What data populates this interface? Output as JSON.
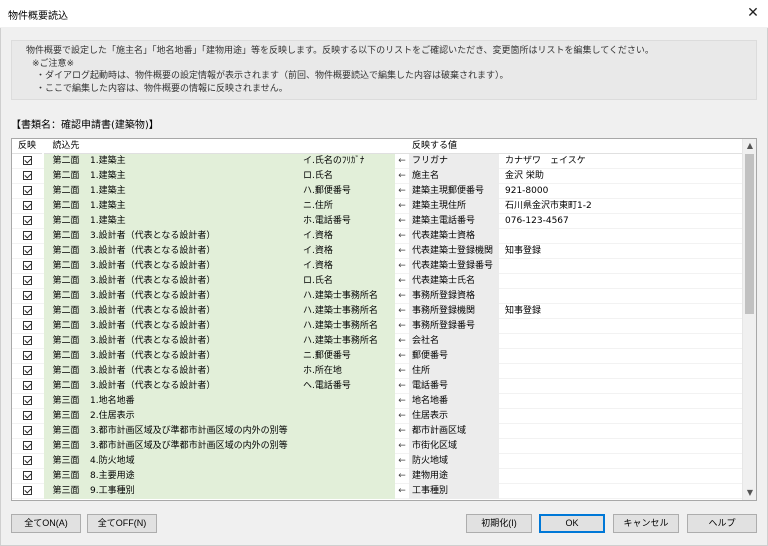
{
  "window": {
    "title": "物件概要読込",
    "close_glyph": "✕"
  },
  "notice": {
    "lines": [
      "物件概要で設定した「施主名」「地名地番」「建物用途」等を反映します。反映する以下のリストをご確認いただき、変更箇所はリストを編集してください。",
      "※ご注意※",
      "・ダイアログ起動時は、物件概要の設定情報が表示されます（前回、物件概要読込で編集した内容は破棄されます）。",
      "・ここで編集した内容は、物件概要の情報に反映されません。"
    ]
  },
  "document": {
    "name_label": "【書類名：確認申請書(建築物)】"
  },
  "grid": {
    "headers": {
      "reflect": "反映",
      "source": "読込先",
      "item": "",
      "sub": "",
      "arrow": "",
      "target": "反映する値",
      "value": ""
    },
    "rows": [
      {
        "checked": true,
        "sheet": "第二面",
        "item": "1.建築主",
        "sub": "イ.氏名のﾌﾘｶﾞﾅ",
        "arrow": "←",
        "target": "フリガナ",
        "value": "カナザワ　ェイスケ"
      },
      {
        "checked": true,
        "sheet": "第二面",
        "item": "1.建築主",
        "sub": "ロ.氏名",
        "arrow": "←",
        "target": "施主名",
        "value": "金沢 栄助"
      },
      {
        "checked": true,
        "sheet": "第二面",
        "item": "1.建築主",
        "sub": "ハ.郵便番号",
        "arrow": "←",
        "target": "建築主現郵便番号",
        "value": "921-8000"
      },
      {
        "checked": true,
        "sheet": "第二面",
        "item": "1.建築主",
        "sub": "ニ.住所",
        "arrow": "←",
        "target": "建築主現住所",
        "value": "石川県金沢市東町1-2"
      },
      {
        "checked": true,
        "sheet": "第二面",
        "item": "1.建築主",
        "sub": "ホ.電話番号",
        "arrow": "←",
        "target": "建築主電話番号",
        "value": "076-123-4567"
      },
      {
        "checked": true,
        "sheet": "第二面",
        "item": "3.設計者（代表となる設計者）",
        "sub": "イ.資格",
        "arrow": "←",
        "target": "代表建築士資格",
        "value": ""
      },
      {
        "checked": true,
        "sheet": "第二面",
        "item": "3.設計者（代表となる設計者）",
        "sub": "イ.資格",
        "arrow": "←",
        "target": "代表建築士登録機関",
        "value": "知事登録"
      },
      {
        "checked": true,
        "sheet": "第二面",
        "item": "3.設計者（代表となる設計者）",
        "sub": "イ.資格",
        "arrow": "←",
        "target": "代表建築士登録番号",
        "value": ""
      },
      {
        "checked": true,
        "sheet": "第二面",
        "item": "3.設計者（代表となる設計者）",
        "sub": "ロ.氏名",
        "arrow": "←",
        "target": "代表建築士氏名",
        "value": ""
      },
      {
        "checked": true,
        "sheet": "第二面",
        "item": "3.設計者（代表となる設計者）",
        "sub": "ハ.建築士事務所名",
        "arrow": "←",
        "target": "事務所登録資格",
        "value": ""
      },
      {
        "checked": true,
        "sheet": "第二面",
        "item": "3.設計者（代表となる設計者）",
        "sub": "ハ.建築士事務所名",
        "arrow": "←",
        "target": "事務所登録機関",
        "value": "知事登録"
      },
      {
        "checked": true,
        "sheet": "第二面",
        "item": "3.設計者（代表となる設計者）",
        "sub": "ハ.建築士事務所名",
        "arrow": "←",
        "target": "事務所登録番号",
        "value": ""
      },
      {
        "checked": true,
        "sheet": "第二面",
        "item": "3.設計者（代表となる設計者）",
        "sub": "ハ.建築士事務所名",
        "arrow": "←",
        "target": "会社名",
        "value": ""
      },
      {
        "checked": true,
        "sheet": "第二面",
        "item": "3.設計者（代表となる設計者）",
        "sub": "ニ.郵便番号",
        "arrow": "←",
        "target": "郵便番号",
        "value": ""
      },
      {
        "checked": true,
        "sheet": "第二面",
        "item": "3.設計者（代表となる設計者）",
        "sub": "ホ.所在地",
        "arrow": "←",
        "target": "住所",
        "value": ""
      },
      {
        "checked": true,
        "sheet": "第二面",
        "item": "3.設計者（代表となる設計者）",
        "sub": "ヘ.電話番号",
        "arrow": "←",
        "target": "電話番号",
        "value": ""
      },
      {
        "checked": true,
        "sheet": "第三面",
        "item": "1.地名地番",
        "sub": "",
        "arrow": "←",
        "target": "地名地番",
        "value": ""
      },
      {
        "checked": true,
        "sheet": "第三面",
        "item": "2.住居表示",
        "sub": "",
        "arrow": "←",
        "target": "住居表示",
        "value": ""
      },
      {
        "checked": true,
        "sheet": "第三面",
        "item": "3.都市計画区域及び準都市計画区域の内外の別等",
        "sub": "",
        "arrow": "←",
        "target": "都市計画区域",
        "value": ""
      },
      {
        "checked": true,
        "sheet": "第三面",
        "item": "3.都市計画区域及び準都市計画区域の内外の別等",
        "sub": "",
        "arrow": "←",
        "target": "市街化区域",
        "value": ""
      },
      {
        "checked": true,
        "sheet": "第三面",
        "item": "4.防火地域",
        "sub": "",
        "arrow": "←",
        "target": "防火地域",
        "value": ""
      },
      {
        "checked": true,
        "sheet": "第三面",
        "item": "8.主要用途",
        "sub": "",
        "arrow": "←",
        "target": "建物用途",
        "value": ""
      },
      {
        "checked": true,
        "sheet": "第三面",
        "item": "9.工事種別",
        "sub": "",
        "arrow": "←",
        "target": "工事種別",
        "value": ""
      }
    ]
  },
  "buttons": {
    "all_on": "全てON(A)",
    "all_off": "全てOFF(N)",
    "reset": "初期化(I)",
    "ok": "OK",
    "cancel": "キャンセル",
    "help": "ヘルプ"
  },
  "scrollbar": {
    "up_glyph": "▲",
    "down_glyph": "▼"
  }
}
